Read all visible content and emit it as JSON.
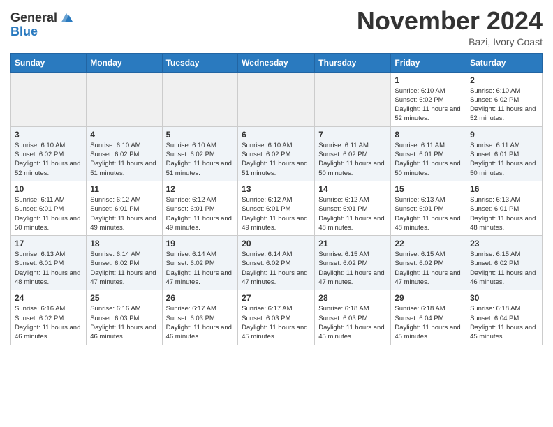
{
  "header": {
    "logo_general": "General",
    "logo_blue": "Blue",
    "month_title": "November 2024",
    "location": "Bazi, Ivory Coast"
  },
  "weekdays": [
    "Sunday",
    "Monday",
    "Tuesday",
    "Wednesday",
    "Thursday",
    "Friday",
    "Saturday"
  ],
  "weeks": [
    [
      {
        "day": "",
        "empty": true
      },
      {
        "day": "",
        "empty": true
      },
      {
        "day": "",
        "empty": true
      },
      {
        "day": "",
        "empty": true
      },
      {
        "day": "",
        "empty": true
      },
      {
        "day": "1",
        "sunrise": "Sunrise: 6:10 AM",
        "sunset": "Sunset: 6:02 PM",
        "daylight": "Daylight: 11 hours and 52 minutes."
      },
      {
        "day": "2",
        "sunrise": "Sunrise: 6:10 AM",
        "sunset": "Sunset: 6:02 PM",
        "daylight": "Daylight: 11 hours and 52 minutes."
      }
    ],
    [
      {
        "day": "3",
        "sunrise": "Sunrise: 6:10 AM",
        "sunset": "Sunset: 6:02 PM",
        "daylight": "Daylight: 11 hours and 52 minutes."
      },
      {
        "day": "4",
        "sunrise": "Sunrise: 6:10 AM",
        "sunset": "Sunset: 6:02 PM",
        "daylight": "Daylight: 11 hours and 51 minutes."
      },
      {
        "day": "5",
        "sunrise": "Sunrise: 6:10 AM",
        "sunset": "Sunset: 6:02 PM",
        "daylight": "Daylight: 11 hours and 51 minutes."
      },
      {
        "day": "6",
        "sunrise": "Sunrise: 6:10 AM",
        "sunset": "Sunset: 6:02 PM",
        "daylight": "Daylight: 11 hours and 51 minutes."
      },
      {
        "day": "7",
        "sunrise": "Sunrise: 6:11 AM",
        "sunset": "Sunset: 6:02 PM",
        "daylight": "Daylight: 11 hours and 50 minutes."
      },
      {
        "day": "8",
        "sunrise": "Sunrise: 6:11 AM",
        "sunset": "Sunset: 6:01 PM",
        "daylight": "Daylight: 11 hours and 50 minutes."
      },
      {
        "day": "9",
        "sunrise": "Sunrise: 6:11 AM",
        "sunset": "Sunset: 6:01 PM",
        "daylight": "Daylight: 11 hours and 50 minutes."
      }
    ],
    [
      {
        "day": "10",
        "sunrise": "Sunrise: 6:11 AM",
        "sunset": "Sunset: 6:01 PM",
        "daylight": "Daylight: 11 hours and 50 minutes."
      },
      {
        "day": "11",
        "sunrise": "Sunrise: 6:12 AM",
        "sunset": "Sunset: 6:01 PM",
        "daylight": "Daylight: 11 hours and 49 minutes."
      },
      {
        "day": "12",
        "sunrise": "Sunrise: 6:12 AM",
        "sunset": "Sunset: 6:01 PM",
        "daylight": "Daylight: 11 hours and 49 minutes."
      },
      {
        "day": "13",
        "sunrise": "Sunrise: 6:12 AM",
        "sunset": "Sunset: 6:01 PM",
        "daylight": "Daylight: 11 hours and 49 minutes."
      },
      {
        "day": "14",
        "sunrise": "Sunrise: 6:12 AM",
        "sunset": "Sunset: 6:01 PM",
        "daylight": "Daylight: 11 hours and 48 minutes."
      },
      {
        "day": "15",
        "sunrise": "Sunrise: 6:13 AM",
        "sunset": "Sunset: 6:01 PM",
        "daylight": "Daylight: 11 hours and 48 minutes."
      },
      {
        "day": "16",
        "sunrise": "Sunrise: 6:13 AM",
        "sunset": "Sunset: 6:01 PM",
        "daylight": "Daylight: 11 hours and 48 minutes."
      }
    ],
    [
      {
        "day": "17",
        "sunrise": "Sunrise: 6:13 AM",
        "sunset": "Sunset: 6:01 PM",
        "daylight": "Daylight: 11 hours and 48 minutes."
      },
      {
        "day": "18",
        "sunrise": "Sunrise: 6:14 AM",
        "sunset": "Sunset: 6:02 PM",
        "daylight": "Daylight: 11 hours and 47 minutes."
      },
      {
        "day": "19",
        "sunrise": "Sunrise: 6:14 AM",
        "sunset": "Sunset: 6:02 PM",
        "daylight": "Daylight: 11 hours and 47 minutes."
      },
      {
        "day": "20",
        "sunrise": "Sunrise: 6:14 AM",
        "sunset": "Sunset: 6:02 PM",
        "daylight": "Daylight: 11 hours and 47 minutes."
      },
      {
        "day": "21",
        "sunrise": "Sunrise: 6:15 AM",
        "sunset": "Sunset: 6:02 PM",
        "daylight": "Daylight: 11 hours and 47 minutes."
      },
      {
        "day": "22",
        "sunrise": "Sunrise: 6:15 AM",
        "sunset": "Sunset: 6:02 PM",
        "daylight": "Daylight: 11 hours and 47 minutes."
      },
      {
        "day": "23",
        "sunrise": "Sunrise: 6:15 AM",
        "sunset": "Sunset: 6:02 PM",
        "daylight": "Daylight: 11 hours and 46 minutes."
      }
    ],
    [
      {
        "day": "24",
        "sunrise": "Sunrise: 6:16 AM",
        "sunset": "Sunset: 6:02 PM",
        "daylight": "Daylight: 11 hours and 46 minutes."
      },
      {
        "day": "25",
        "sunrise": "Sunrise: 6:16 AM",
        "sunset": "Sunset: 6:03 PM",
        "daylight": "Daylight: 11 hours and 46 minutes."
      },
      {
        "day": "26",
        "sunrise": "Sunrise: 6:17 AM",
        "sunset": "Sunset: 6:03 PM",
        "daylight": "Daylight: 11 hours and 46 minutes."
      },
      {
        "day": "27",
        "sunrise": "Sunrise: 6:17 AM",
        "sunset": "Sunset: 6:03 PM",
        "daylight": "Daylight: 11 hours and 45 minutes."
      },
      {
        "day": "28",
        "sunrise": "Sunrise: 6:18 AM",
        "sunset": "Sunset: 6:03 PM",
        "daylight": "Daylight: 11 hours and 45 minutes."
      },
      {
        "day": "29",
        "sunrise": "Sunrise: 6:18 AM",
        "sunset": "Sunset: 6:04 PM",
        "daylight": "Daylight: 11 hours and 45 minutes."
      },
      {
        "day": "30",
        "sunrise": "Sunrise: 6:18 AM",
        "sunset": "Sunset: 6:04 PM",
        "daylight": "Daylight: 11 hours and 45 minutes."
      }
    ]
  ]
}
